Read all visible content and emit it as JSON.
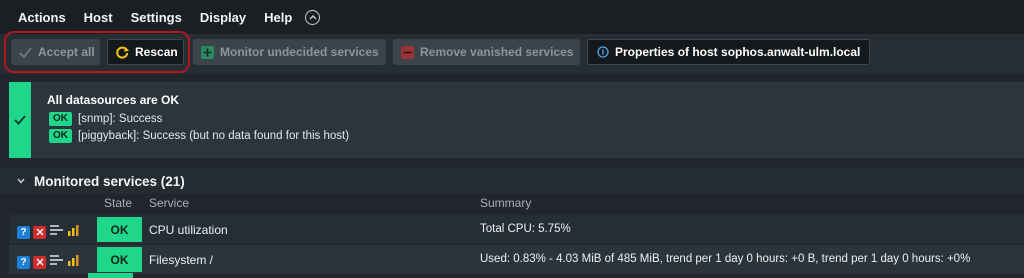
{
  "menu": {
    "items": [
      "Actions",
      "Host",
      "Settings",
      "Display",
      "Help"
    ]
  },
  "toolbar": {
    "accept_all": "Accept all",
    "rescan": "Rescan",
    "monitor_undecided": "Monitor undecided services",
    "remove_vanished": "Remove vanished services",
    "properties": "Properties of host sophos.anwalt-ulm.local"
  },
  "datasources": {
    "title": "All datasources are OK",
    "lines": [
      {
        "badge": "OK",
        "text": "[snmp]: Success"
      },
      {
        "badge": "OK",
        "text": "[piggyback]: Success (but no data found for this host)"
      }
    ]
  },
  "services": {
    "header": "Monitored services (21)",
    "columns": {
      "state": "State",
      "service": "Service",
      "summary": "Summary"
    },
    "rows": [
      {
        "state": "OK",
        "service": "CPU utilization",
        "summary": "Total CPU: 5.75%"
      },
      {
        "state": "OK",
        "service": "Filesystem /",
        "summary": "Used: 0.83% - 4.03 MiB of 485 MiB, trend per 1 day 0 hours: +0 B, trend per 1 day 0 hours: +0%"
      }
    ]
  },
  "colors": {
    "ok": "#1fd68a",
    "highlight": "#b01922",
    "help_icon": "#1e7fd6",
    "delete_icon": "#d12c2c"
  }
}
